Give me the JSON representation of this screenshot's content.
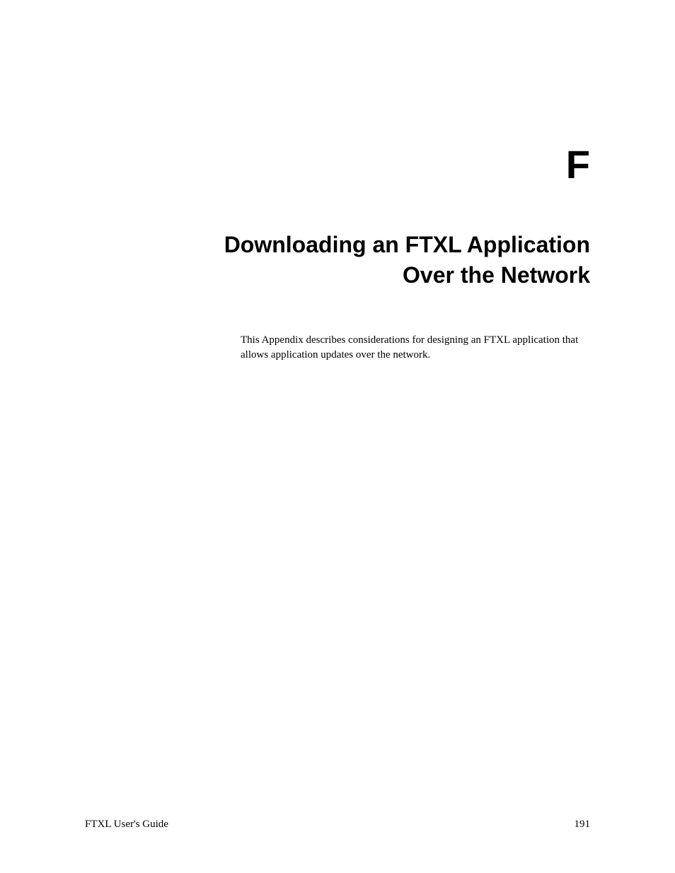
{
  "appendix_letter": "F",
  "title_line1": "Downloading an FTXL Application",
  "title_line2": "Over the Network",
  "description": "This Appendix describes considerations for designing an FTXL application that allows application updates over the network.",
  "footer": {
    "left": "FTXL User's Guide",
    "right": "191"
  }
}
